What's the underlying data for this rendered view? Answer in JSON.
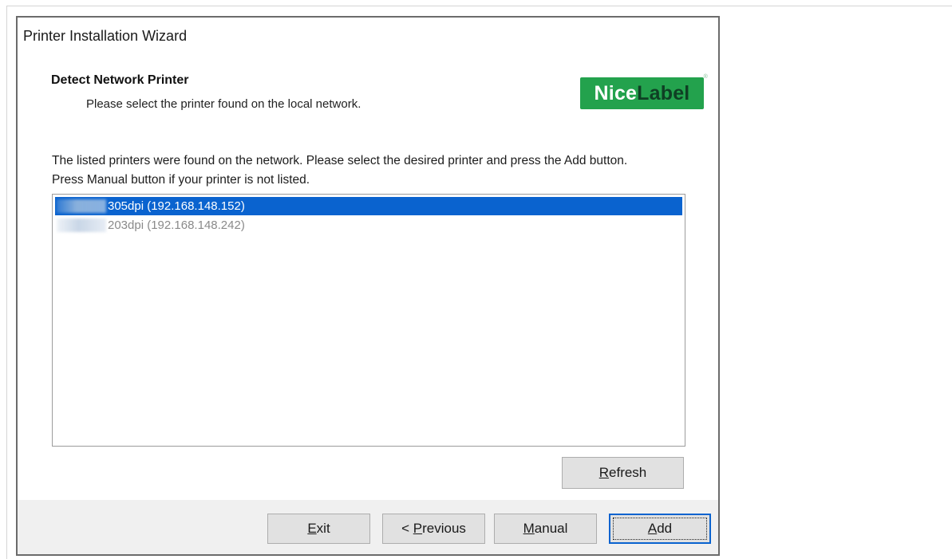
{
  "window": {
    "title": "Printer Installation Wizard"
  },
  "header": {
    "heading": "Detect Network Printer",
    "subheading": "Please select the printer found on the local network.",
    "logo": {
      "part1": "Nice",
      "part2": "Label",
      "brand_color": "#23a24d"
    }
  },
  "instructions": "The listed printers were found on the network. Please select the desired printer and press the Add button. Press Manual button if your printer is not listed.",
  "printers": [
    {
      "label": "305dpi (192.168.148.152)",
      "selected": true
    },
    {
      "label": "203dpi (192.168.148.242)",
      "selected": false
    }
  ],
  "buttons": {
    "refresh": {
      "mnemonic": "R",
      "rest": "efresh"
    },
    "exit": {
      "mnemonic": "E",
      "rest": "xit"
    },
    "previous": {
      "prefix": "< ",
      "mnemonic": "P",
      "rest": "revious"
    },
    "manual": {
      "mnemonic": "M",
      "rest": "anual"
    },
    "add": {
      "mnemonic": "A",
      "rest": "dd"
    }
  },
  "colors": {
    "selection": "#0a63cf",
    "button_face": "#e1e1e1",
    "footer_bg": "#f0f0f0"
  }
}
